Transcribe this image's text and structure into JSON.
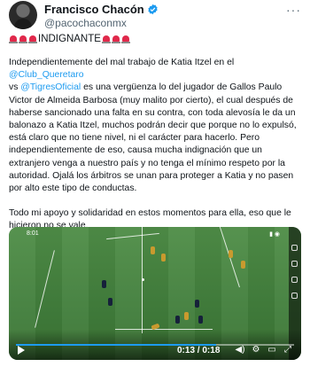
{
  "author": {
    "display_name": "Francisco Chacón",
    "handle": "@pacochaconmx"
  },
  "headline": {
    "emoji_icon": "police-siren-icon",
    "text": "INDIGNANTE"
  },
  "body": {
    "p1_a": "Independientemente del mal trabajo de Katia Itzel en el",
    "mention1": "@Club_Queretaro",
    "p1_b_prefix": "vs",
    "mention2": "@TigresOficial",
    "p1_c": "es una vergüenza lo del jugador de Gallos Paulo Victor de Almeida Barbosa (muy malito por cierto), el cual después de haberse sancionado una falta en su contra, con toda alevosía le da un balonazo a Katia Itzel, muchos podrán decir que porque no lo expulsó, está claro que no tiene nivel, ni el carácter para hacerlo. Pero independientemente de eso, causa mucha indignación que un extranjero venga a nuestro país y no tenga el mínimo respeto por la autoridad. Ojalá los árbitros se unan para proteger a Katia y no pasen por alto este tipo de conductas.",
    "p2": "Todo mi apoyo y solidaridad en estos momentos para ella, eso que le hicieron no se vale."
  },
  "video": {
    "phone_clock": "8:01",
    "current_time": "0:13",
    "duration": "0:18",
    "time_separator": " / ",
    "progress_fraction": 0.72
  },
  "colors": {
    "link": "#1d9bf0",
    "verified": "#1d9bf0"
  }
}
